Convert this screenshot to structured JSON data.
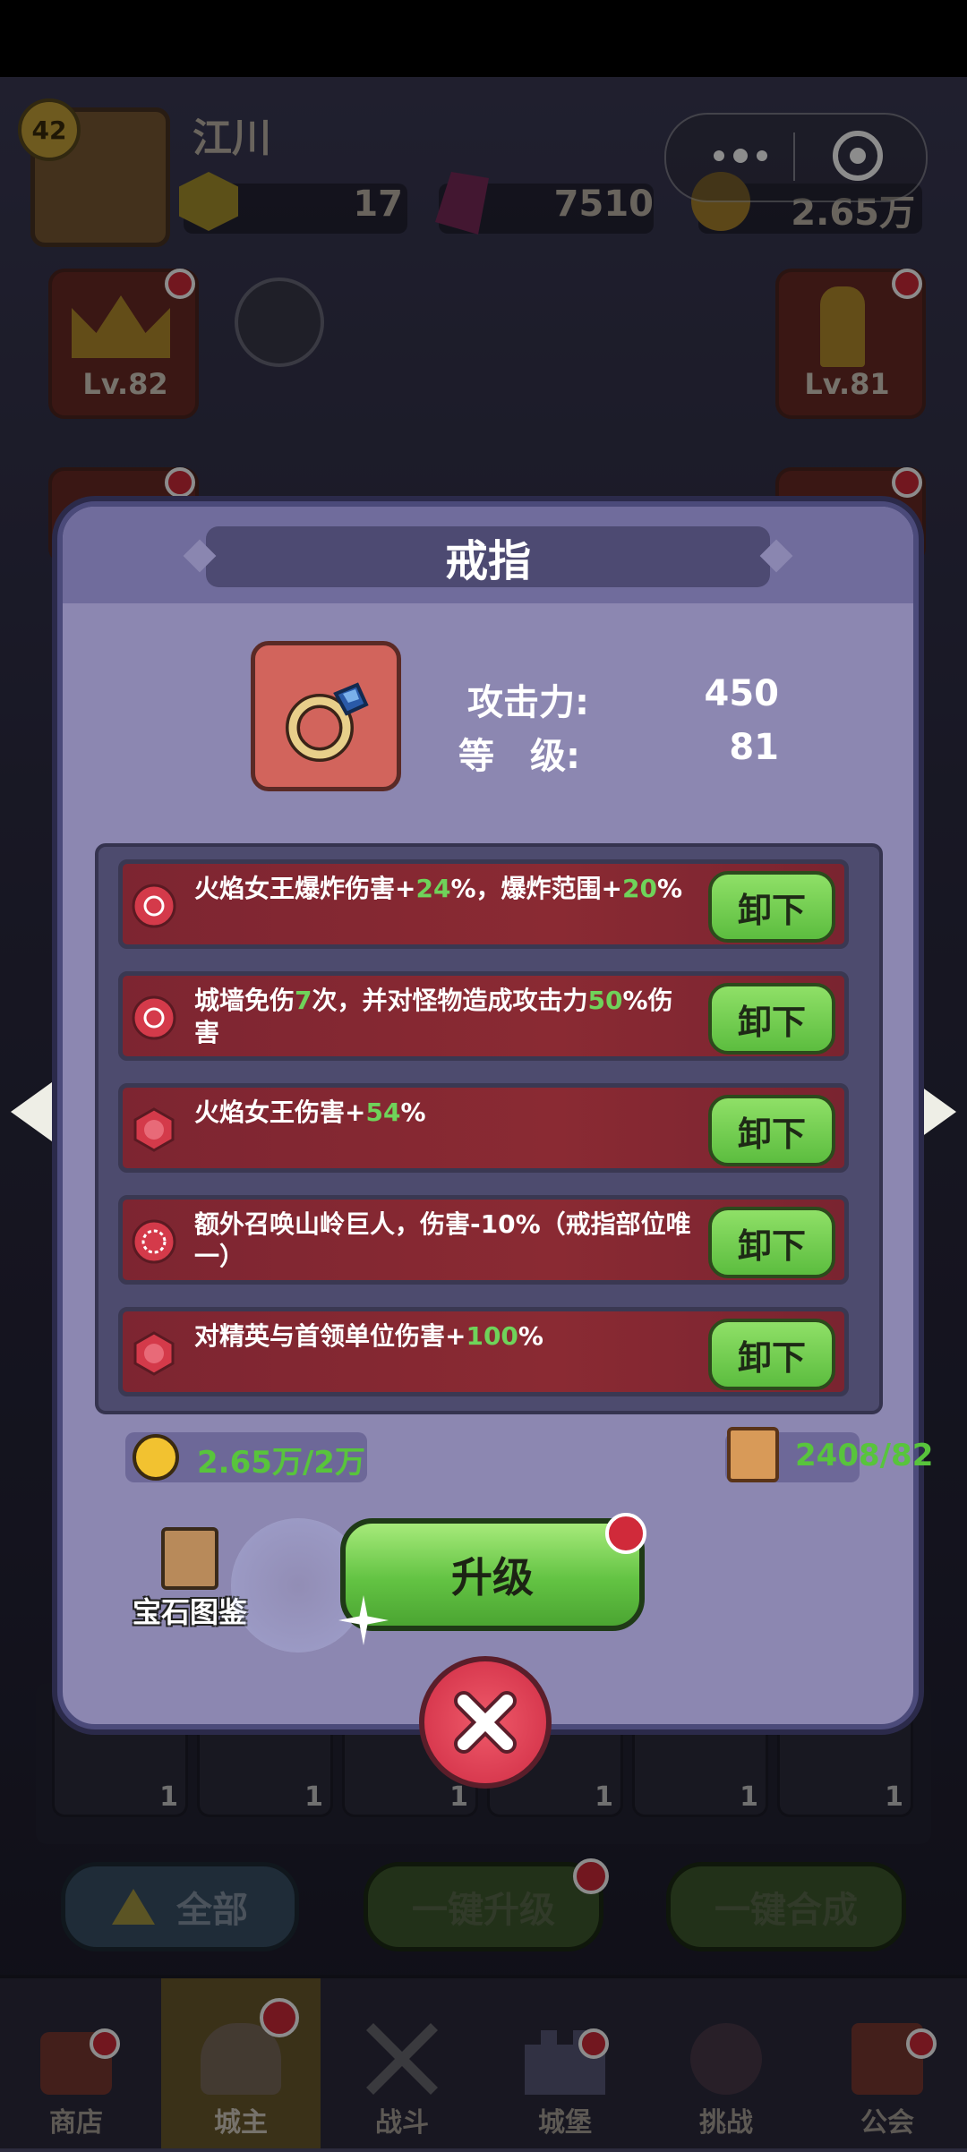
{
  "player": {
    "level": "42",
    "name": "江川"
  },
  "resources": {
    "tokens": "17",
    "gems": "7510",
    "gold": "2.65万"
  },
  "side_cards": {
    "left_level": "Lv.82",
    "right_level": "Lv.81"
  },
  "dialog": {
    "title": "戒指",
    "attack_label": "攻击力:",
    "attack_value": "450",
    "level_label": "等　级:",
    "level_value": "81",
    "gems": [
      {
        "pre": "火焰女王爆炸伤害+",
        "g1": "24",
        "mid": "%，爆炸范围+",
        "g2": "20",
        "post": "%",
        "button": "卸下"
      },
      {
        "pre": "城墙免伤",
        "g1": "7",
        "mid": "次，并对怪物造成攻击力",
        "g2": "50",
        "post": "%伤害",
        "button": "卸下"
      },
      {
        "pre": "火焰女王伤害+",
        "g1": "54",
        "mid": "%",
        "g2": "",
        "post": "",
        "button": "卸下"
      },
      {
        "pre": "额外召唤山岭巨人，伤害-10%（戒指部位唯一）",
        "g1": "",
        "mid": "",
        "g2": "",
        "post": "",
        "button": "卸下"
      },
      {
        "pre": "对精英与首领单位伤害+",
        "g1": "100",
        "mid": "%",
        "g2": "",
        "post": "",
        "button": "卸下"
      }
    ],
    "coin_cost": "2.65万/2万",
    "book_cost": "2408/82",
    "gem_codex_label": "宝石图鉴",
    "upgrade_label": "升级"
  },
  "bottom_buttons": {
    "all": "全部",
    "upgrade_all": "一键升级",
    "merge_all": "一键合成"
  },
  "slot_counts": [
    "1",
    "1",
    "1",
    "1",
    "1",
    "1"
  ],
  "nav": [
    "商店",
    "城主",
    "战斗",
    "城堡",
    "挑战",
    "公会"
  ],
  "colors": {
    "accent_green": "#58c43c",
    "dialog_bg": "#8e89b5",
    "gem_row": "#8a2a33"
  }
}
